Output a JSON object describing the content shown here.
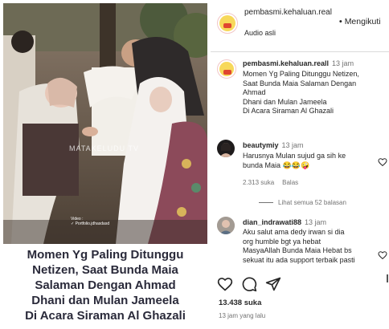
{
  "post": {
    "caption_lines": [
      "Momen Yg Paling Ditunggu",
      "Netizen, Saat Bunda Maia",
      "Salaman Dengan Ahmad",
      "Dhani dan Mulan Jameela",
      "Di Acara Siraman Al Ghazali"
    ],
    "watermark": "MATAKELUDU TV",
    "credit_lines": [
      "Video :",
      "✓ Portfolio.jdhasdasd"
    ]
  },
  "header": {
    "username": "pembasmi.kehaluan.real",
    "audio": "Audio asli",
    "follow_label": "Mengikuti",
    "follow_dot": "•"
  },
  "comments": [
    {
      "user": "pembasmi.kehaluan.reall",
      "time": "13 jam",
      "text": "Momen Yg Paling Ditunggu Netizen,\nSaat Bunda Maia Salaman Dengan\nAhmad\nDhani dan Mulan Jameela\nDi Acara Siraman Al Ghazali",
      "avatar": "brand-avatar"
    },
    {
      "user": "beautymiy",
      "time": "13 jam",
      "text": "Harusnya Mulan sujud ga sih ke\nbunda Maia 😂😂🤪",
      "likes": "2.313 suka",
      "reply": "Balas",
      "view_replies": "Lihat semua 52 balasan",
      "avatar": "user-avatar-dark"
    },
    {
      "user": "dian_indrawati88",
      "time": "13 jam",
      "text": "Aku salut ama dedy irwan si dia\norg humble bgt ya hebat\nMasyaAllah Bunda Maia Hebat bs\nsekuat itu ada support terbaik pasti",
      "avatar": "user-avatar-gray"
    }
  ],
  "footer": {
    "likes": "13.438 suka",
    "posted": "13 jam yang lalu"
  },
  "icons": {
    "like": "heart-icon",
    "comment": "comment-bubble-icon",
    "share": "paper-plane-icon",
    "comment_like": "heart-icon"
  },
  "colors": {
    "text": "#262626",
    "muted": "#737373",
    "caption": "#2a2a3a",
    "divider": "#dbdbdb"
  }
}
